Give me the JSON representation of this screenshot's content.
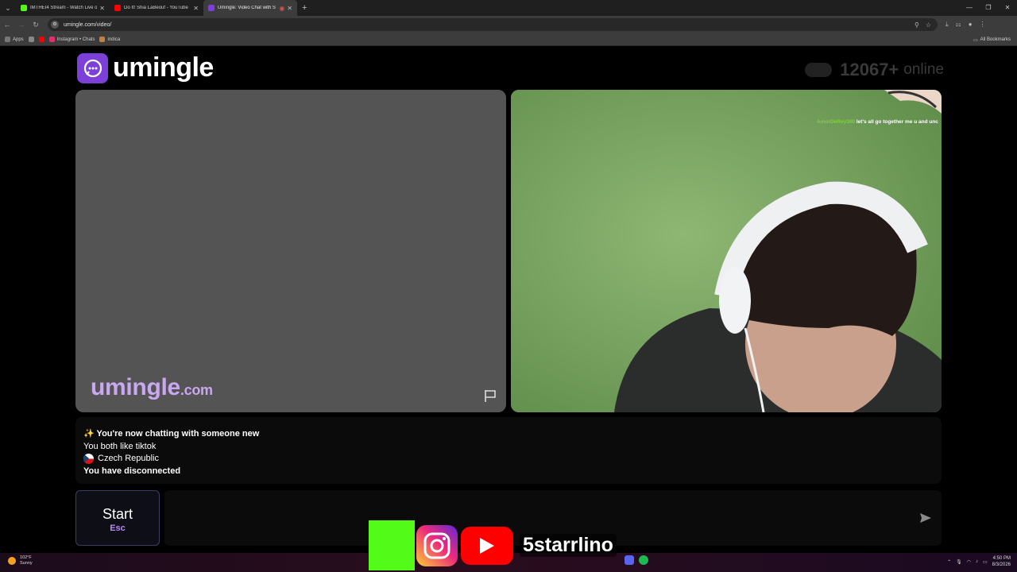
{
  "browser": {
    "tabs": [
      {
        "title": "IMTHEI4 Stream - Watch Live o",
        "favicon_color": "#53fc18",
        "active": false
      },
      {
        "title": "Do It! Shia LaBeouf - YouTube",
        "favicon_color": "#ff0000",
        "active": false
      },
      {
        "title": "Umingle: Video Chat with S",
        "favicon_color": "#7c3fd8",
        "active": true
      }
    ],
    "new_tab_glyph": "+",
    "url": "umingle.com/video/",
    "bookmarks": [
      {
        "label": "Apps",
        "color": "#777777"
      },
      {
        "label": "",
        "color": "#888888"
      },
      {
        "label": "",
        "color": "#ff0000"
      },
      {
        "label": "Instagram • Chats",
        "color": "#e1306c"
      },
      {
        "label": "indica",
        "color": "#c08040"
      }
    ],
    "all_bookmarks_label": "All Bookmarks"
  },
  "header": {
    "logo_text": "umingle",
    "online_count": "12067+",
    "online_label": "online"
  },
  "video_left": {
    "watermark_main": "umingle",
    "watermark_suffix": ".com"
  },
  "video_right": {
    "overlay_chat_user": "AmorDeRey360",
    "overlay_chat_message": "let's all go together me u and unc"
  },
  "chat_log": {
    "line1": "✨ You're now chatting with someone new",
    "line2": "You both like tiktok",
    "line3": "Czech Republic",
    "line4": "You have disconnected"
  },
  "controls": {
    "start_label": "Start",
    "start_shortcut": "Esc",
    "message_placeholder": ""
  },
  "stream_overlay": {
    "handle": "5starrlino"
  },
  "taskbar": {
    "temperature": "102°F",
    "condition": "Sunny",
    "time": "4:50 PM",
    "date": "8/3/2026"
  },
  "colors": {
    "accent": "#7c3fd8",
    "watermark": "#c9a8f0",
    "shortcut": "#b58cf5"
  }
}
